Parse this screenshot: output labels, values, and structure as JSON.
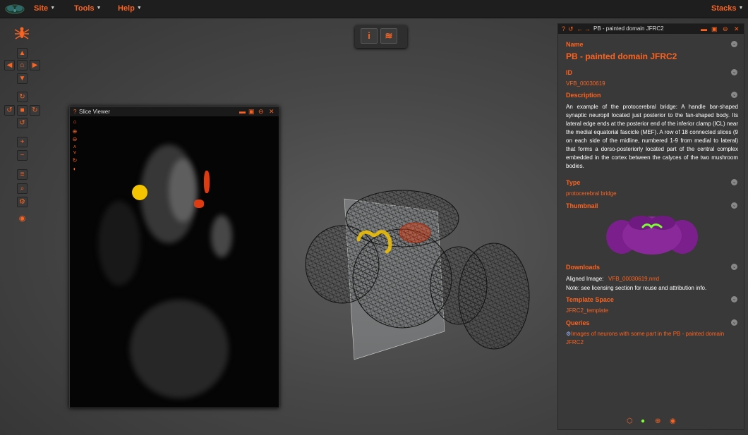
{
  "navbar": {
    "site_label": "Site",
    "tools_label": "Tools",
    "help_label": "Help",
    "stacks_label": "Stacks"
  },
  "slice_viewer": {
    "help_icon": "?",
    "title": "Slice Viewer"
  },
  "term_info": {
    "help_icon": "?",
    "title": "PB - painted domain JFRC2",
    "name_heading": "Name",
    "name_value": "PB - painted domain JFRC2",
    "id_heading": "ID",
    "id_value": "VFB_00030619",
    "description_heading": "Description",
    "description_text": "An example of the protocerebral bridge: A handle bar-shaped synaptic neuropil located just posterior to the fan-shaped body. Its lateral edge ends at the posterior end of the inferior clamp (ICL) near the medial equatorial fascicle (MEF). A row of 18 connected slices (9 on each side of the midline, numbered 1-9 from medial to lateral) that forms a dorso-posteriorly located part of the central complex embedded in the cortex between the calyces of the two mushroom bodies.",
    "type_heading": "Type",
    "type_value": "protocerebral bridge",
    "thumbnail_heading": "Thumbnail",
    "downloads_heading": "Downloads",
    "aligned_image_label": "Aligned Image:",
    "aligned_image_link": "VFB_00030619.nrrd",
    "downloads_note": "Note: see licensing section for reuse and attribution info.",
    "template_heading": "Template Space",
    "template_value": "JFRC2_template",
    "queries_heading": "Queries",
    "query_link": "Images of neurons with some part in the PB - painted domain JFRC2"
  },
  "colors": {
    "accent": "#fc6320",
    "navbar_bg": "#1e1e1e",
    "panel_bg": "#393939",
    "highlight_yellow": "#f5c400",
    "highlight_red": "#e03a10",
    "thumbnail_brain": "#7b1f8c",
    "thumbnail_pb": "#7dff33"
  }
}
